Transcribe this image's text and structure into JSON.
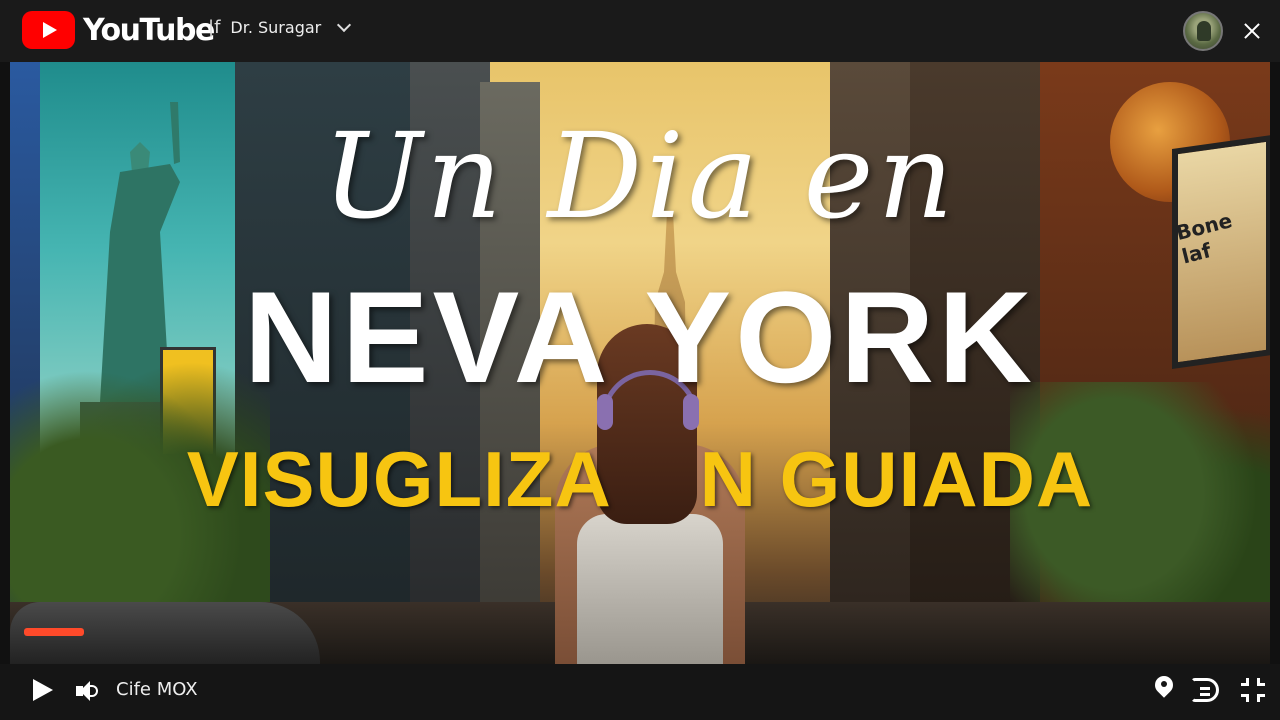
{
  "header": {
    "brand": "YouTube",
    "divider": "|f",
    "channel_name": "Dr. Suragar"
  },
  "thumbnail": {
    "title_line_1": "Un Dia en",
    "title_line_2": "NEVA YORK",
    "title_line_3": "VISUGLIZA    N GUIADA",
    "billboard_text": "Bone laf"
  },
  "controls": {
    "label": "Cife MOX"
  },
  "colors": {
    "brand_red": "#ff0000",
    "title_white": "#ffffff",
    "title_yellow": "#f7c511",
    "bar_bg": "#1a1a1a"
  },
  "icons": [
    "youtube-logo-icon",
    "chevron-down-icon",
    "close-icon",
    "play-icon",
    "volume-icon",
    "location-pin-icon",
    "cast-icon",
    "fullscreen-icon"
  ]
}
